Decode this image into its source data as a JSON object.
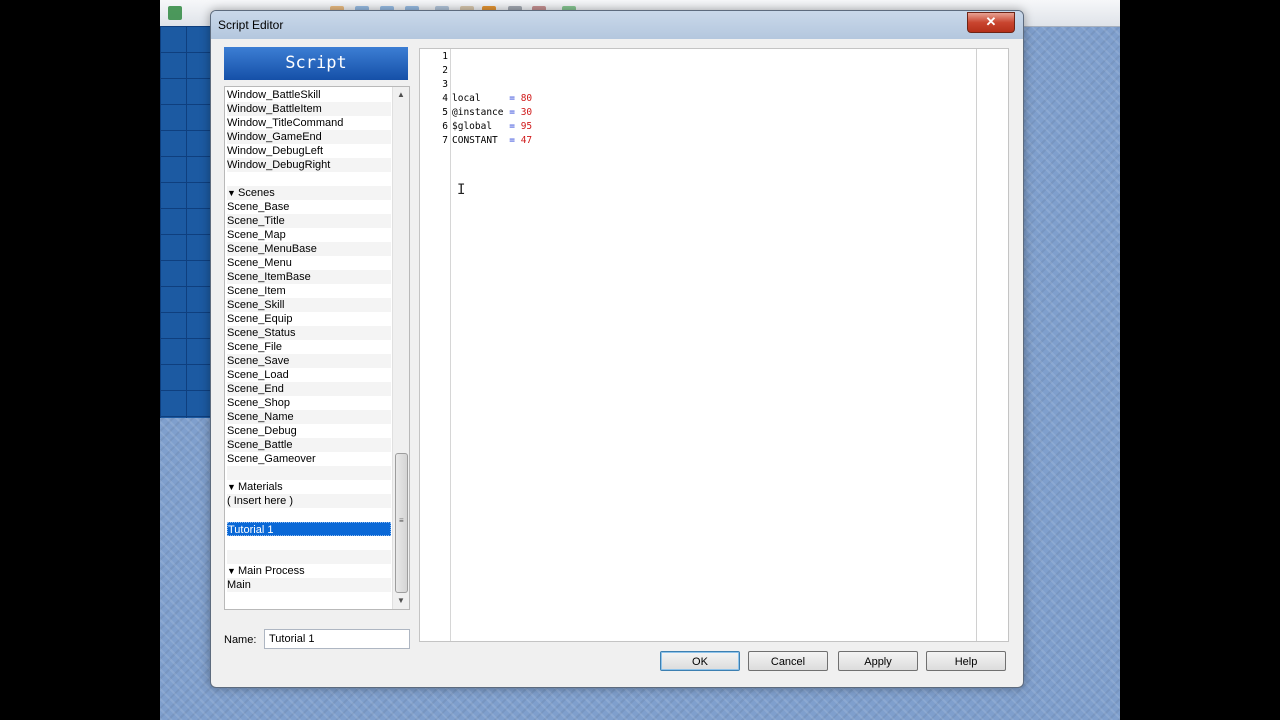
{
  "window": {
    "title": "Script Editor",
    "close_label": "✕"
  },
  "sidebar": {
    "header": "Script",
    "rows": [
      {
        "label": "Window_BattleSkill",
        "kind": "item"
      },
      {
        "label": "Window_BattleItem",
        "kind": "item"
      },
      {
        "label": "Window_TitleCommand",
        "kind": "item"
      },
      {
        "label": "Window_GameEnd",
        "kind": "item"
      },
      {
        "label": "Window_DebugLeft",
        "kind": "item"
      },
      {
        "label": "Window_DebugRight",
        "kind": "item"
      },
      {
        "label": "",
        "kind": "blank"
      },
      {
        "label": "Scenes",
        "kind": "header"
      },
      {
        "label": "Scene_Base",
        "kind": "item"
      },
      {
        "label": "Scene_Title",
        "kind": "item"
      },
      {
        "label": "Scene_Map",
        "kind": "item"
      },
      {
        "label": "Scene_MenuBase",
        "kind": "item"
      },
      {
        "label": "Scene_Menu",
        "kind": "item"
      },
      {
        "label": "Scene_ItemBase",
        "kind": "item"
      },
      {
        "label": "Scene_Item",
        "kind": "item"
      },
      {
        "label": "Scene_Skill",
        "kind": "item"
      },
      {
        "label": "Scene_Equip",
        "kind": "item"
      },
      {
        "label": "Scene_Status",
        "kind": "item"
      },
      {
        "label": "Scene_File",
        "kind": "item"
      },
      {
        "label": "Scene_Save",
        "kind": "item"
      },
      {
        "label": "Scene_Load",
        "kind": "item"
      },
      {
        "label": "Scene_End",
        "kind": "item"
      },
      {
        "label": "Scene_Shop",
        "kind": "item"
      },
      {
        "label": "Scene_Name",
        "kind": "item"
      },
      {
        "label": "Scene_Debug",
        "kind": "item"
      },
      {
        "label": "Scene_Battle",
        "kind": "item"
      },
      {
        "label": "Scene_Gameover",
        "kind": "item"
      },
      {
        "label": "",
        "kind": "blank"
      },
      {
        "label": "Materials",
        "kind": "header"
      },
      {
        "label": "( Insert here )",
        "kind": "item"
      },
      {
        "label": "",
        "kind": "blank"
      },
      {
        "label": "Tutorial 1",
        "kind": "item",
        "selected": true
      },
      {
        "label": "",
        "kind": "blank"
      },
      {
        "label": "",
        "kind": "blank"
      },
      {
        "label": "Main Process",
        "kind": "header"
      },
      {
        "label": "Main",
        "kind": "item"
      }
    ],
    "name_label": "Name:",
    "name_value": "Tutorial 1"
  },
  "editor": {
    "lines": [
      {
        "n": "1",
        "var": "",
        "op": "",
        "num": ""
      },
      {
        "n": "2",
        "var": "",
        "op": "",
        "num": ""
      },
      {
        "n": "3",
        "var": "",
        "op": "",
        "num": ""
      },
      {
        "n": "4",
        "var": "local",
        "op": "=",
        "num": "80"
      },
      {
        "n": "5",
        "var": "@instance",
        "op": "=",
        "num": "30"
      },
      {
        "n": "6",
        "var": "$global",
        "op": "=",
        "num": "95"
      },
      {
        "n": "7",
        "var": "CONSTANT",
        "op": "=",
        "num": "47"
      }
    ]
  },
  "buttons": {
    "ok": "OK",
    "cancel": "Cancel",
    "apply": "Apply",
    "help": "Help"
  },
  "colors": {
    "selection": "#0a68d6",
    "header_blue": "#1550a8",
    "number_red": "#d01a1a",
    "operator_blue": "#2a42d8"
  }
}
